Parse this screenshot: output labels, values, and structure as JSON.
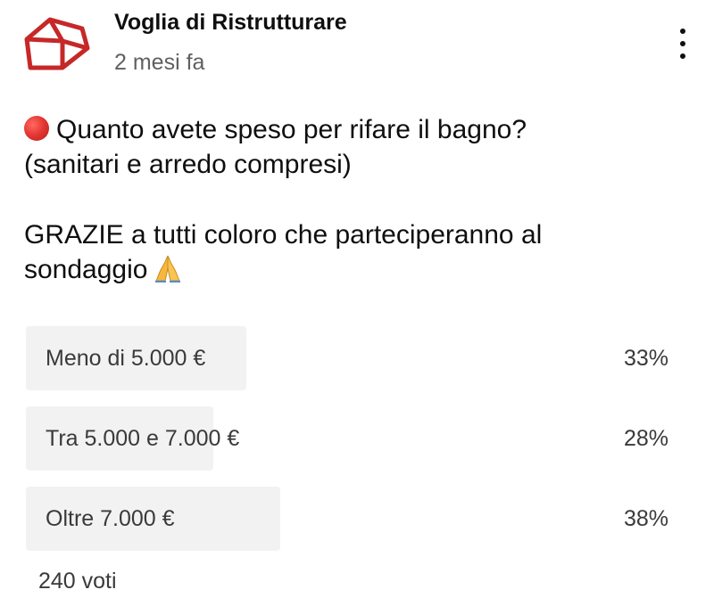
{
  "post": {
    "channel_name": "Voglia di Ristrutturare",
    "timestamp": "2 mesi fa",
    "avatar_icon": "house-outline-icon",
    "menu_icon": "more-vert-icon",
    "accent_color": "#c62828",
    "text": {
      "emoji_1": "red-circle-emoji",
      "line_1": "Quanto avete speso per rifare il bagno?",
      "line_2": "(sanitari e arredo compresi)",
      "line_3": "GRAZIE a tutti coloro che parteciperanno al",
      "line_4": "sondaggio",
      "emoji_2": "folded-hands-emoji"
    }
  },
  "poll": {
    "options": [
      {
        "label": "Meno di 5.000 €",
        "percent_label": "33%",
        "share": 0.33
      },
      {
        "label": "Tra 5.000 e 7.000 €",
        "percent_label": "28%",
        "share": 0.28
      },
      {
        "label": "Oltre 7.000 €",
        "percent_label": "38%",
        "share": 0.38
      }
    ],
    "votes": "240 voti"
  }
}
